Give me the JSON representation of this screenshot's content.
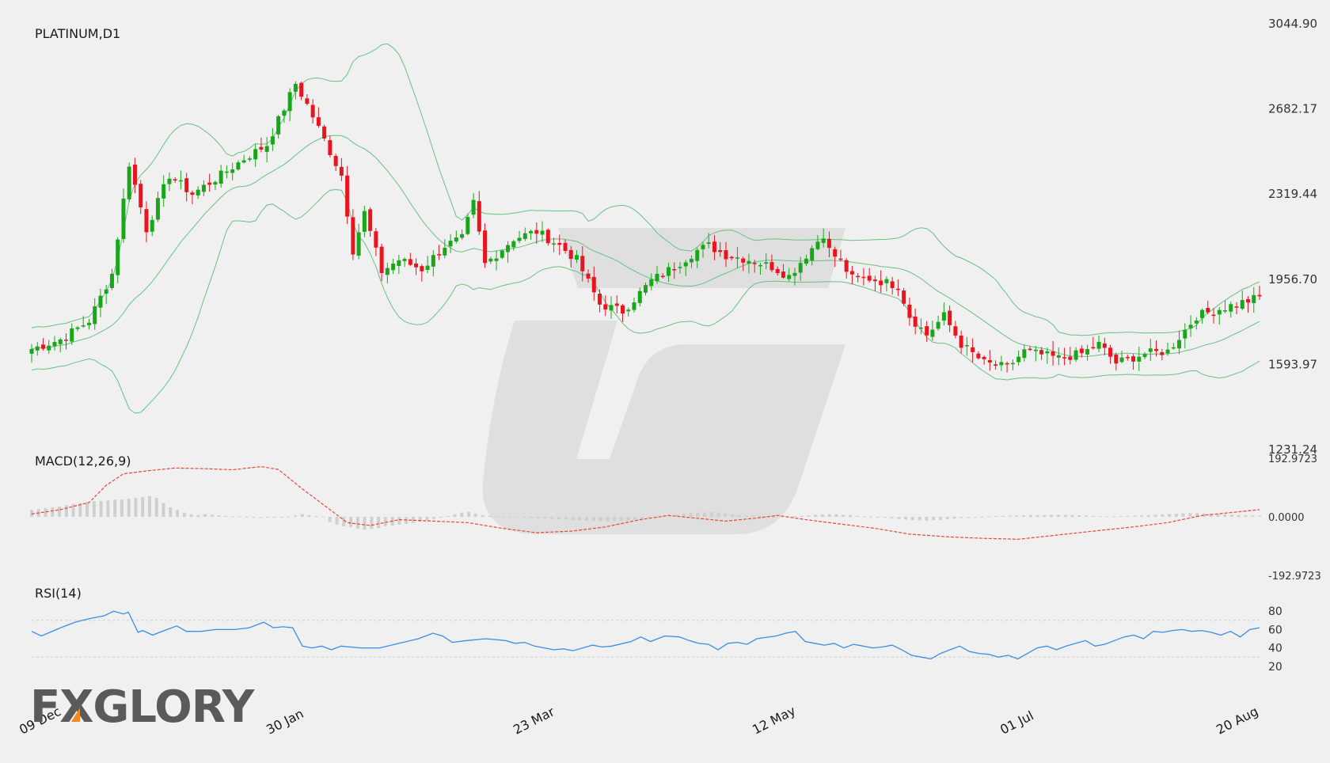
{
  "chart_data": [
    {
      "type": "candlestick",
      "title": "PLATINUM,D1",
      "y_ticks": [
        "3044.90",
        "2682.17",
        "2319.44",
        "1956.70",
        "1593.97",
        "1231.24"
      ],
      "ylim": [
        1231.24,
        3044.9
      ],
      "x_ticks": [
        "09 Dec",
        "30 Jan",
        "23 Mar",
        "12 May",
        "01 Jul",
        "20 Aug"
      ],
      "overlay": "Bollinger Bands",
      "grid": false,
      "colors": {
        "up": "#1aa61a",
        "down": "#e8141f",
        "bands": "#66c183"
      },
      "close_path": [
        [
          0,
          1660
        ],
        [
          5,
          1700
        ],
        [
          10,
          1780
        ],
        [
          14,
          1980
        ],
        [
          17,
          2450
        ],
        [
          20,
          2170
        ],
        [
          24,
          2400
        ],
        [
          28,
          2320
        ],
        [
          33,
          2400
        ],
        [
          37,
          2470
        ],
        [
          41,
          2530
        ],
        [
          46,
          2790
        ],
        [
          48,
          2700
        ],
        [
          51,
          2550
        ],
        [
          54,
          2400
        ],
        [
          56,
          2080
        ],
        [
          58,
          2240
        ],
        [
          61,
          1990
        ],
        [
          64,
          2040
        ],
        [
          68,
          2000
        ],
        [
          72,
          2100
        ],
        [
          75,
          2130
        ],
        [
          77,
          2280
        ],
        [
          79,
          2020
        ],
        [
          84,
          2130
        ],
        [
          88,
          2160
        ],
        [
          92,
          2100
        ],
        [
          95,
          2040
        ],
        [
          99,
          1850
        ],
        [
          103,
          1820
        ],
        [
          108,
          1950
        ],
        [
          112,
          2010
        ],
        [
          116,
          2080
        ],
        [
          118,
          2100
        ],
        [
          121,
          2060
        ],
        [
          125,
          2040
        ],
        [
          129,
          2010
        ],
        [
          132,
          1970
        ],
        [
          135,
          2060
        ],
        [
          138,
          2150
        ],
        [
          139,
          2080
        ],
        [
          141,
          2030
        ],
        [
          143,
          1960
        ],
        [
          146,
          1960
        ],
        [
          151,
          1930
        ],
        [
          153,
          1800
        ],
        [
          156,
          1720
        ],
        [
          159,
          1800
        ],
        [
          162,
          1680
        ],
        [
          166,
          1600
        ],
        [
          170,
          1580
        ],
        [
          173,
          1650
        ],
        [
          179,
          1620
        ],
        [
          183,
          1640
        ],
        [
          186,
          1680
        ],
        [
          189,
          1600
        ],
        [
          194,
          1640
        ],
        [
          198,
          1650
        ],
        [
          203,
          1800
        ],
        [
          207,
          1830
        ],
        [
          214,
          1880
        ]
      ]
    },
    {
      "type": "line",
      "title": "MACD(12,26,9)",
      "y_ticks": [
        "192.9723",
        "0.0000",
        "-192.9723"
      ],
      "ylim": [
        -192.9723,
        192.9723
      ],
      "series": [
        {
          "line": "signal",
          "color": "#e8453c",
          "points": [
            [
              0,
              10
            ],
            [
              5,
              25
            ],
            [
              10,
              50
            ],
            [
              13,
              110
            ],
            [
              16,
              150
            ],
            [
              20,
              160
            ],
            [
              25,
              170
            ],
            [
              30,
              168
            ],
            [
              35,
              164
            ],
            [
              40,
              175
            ],
            [
              43,
              165
            ],
            [
              47,
              100
            ],
            [
              51,
              40
            ],
            [
              55,
              -20
            ],
            [
              59,
              -30
            ],
            [
              64,
              -10
            ],
            [
              70,
              -15
            ],
            [
              76,
              -20
            ],
            [
              82,
              -40
            ],
            [
              88,
              -55
            ],
            [
              94,
              -50
            ],
            [
              100,
              -35
            ],
            [
              106,
              -10
            ],
            [
              111,
              5
            ],
            [
              116,
              -5
            ],
            [
              121,
              -15
            ],
            [
              126,
              -5
            ],
            [
              130,
              5
            ],
            [
              135,
              -10
            ],
            [
              141,
              -25
            ],
            [
              147,
              -40
            ],
            [
              153,
              -60
            ],
            [
              160,
              -70
            ],
            [
              166,
              -75
            ],
            [
              172,
              -78
            ],
            [
              178,
              -65
            ],
            [
              185,
              -50
            ],
            [
              192,
              -35
            ],
            [
              198,
              -20
            ],
            [
              204,
              5
            ],
            [
              209,
              15
            ],
            [
              214,
              25
            ]
          ]
        },
        {
          "name": "",
          "type": "histogram",
          "color": "#cfcfcf",
          "values": [
            40,
            45,
            50,
            55,
            60,
            68,
            75,
            80,
            85,
            90,
            92,
            95,
            100,
            100,
            105,
            110,
            115,
            120,
            110,
            80,
            55,
            40,
            25,
            15,
            10,
            15,
            12,
            8,
            5,
            3,
            2,
            1,
            -1,
            -2,
            -3,
            -2,
            -1,
            1,
            8,
            15,
            10,
            5,
            2,
            -30,
            -45,
            -55,
            -60,
            -70,
            -75,
            -70,
            -65,
            -55,
            -50,
            -45,
            -40,
            -35,
            -28,
            -20,
            -12,
            -5,
            5,
            15,
            25,
            28,
            18,
            10,
            5,
            3,
            2,
            1,
            -2,
            -4,
            -6,
            -8,
            -10,
            -12,
            -14,
            -16,
            -18,
            -20,
            -22,
            -24,
            -26,
            -26,
            -24,
            -22,
            -20,
            -16,
            -12,
            -8,
            -4,
            2,
            8,
            14,
            18,
            22,
            25,
            26,
            27,
            24,
            20,
            15,
            12,
            9,
            6,
            4,
            3,
            2,
            2,
            3,
            4,
            6,
            8,
            12,
            14,
            15,
            14,
            12,
            10,
            6,
            3,
            1,
            -2,
            -5,
            -8,
            -12,
            -15,
            -18,
            -20,
            -21,
            -20,
            -18,
            -14,
            -10,
            -6,
            -3,
            -1,
            1,
            3,
            5,
            6,
            7,
            8,
            9,
            10,
            10,
            11,
            12,
            12,
            11,
            10,
            9,
            8,
            6,
            4,
            3,
            3,
            4,
            5,
            6,
            8,
            10,
            12,
            14,
            16,
            18,
            20,
            22,
            22,
            20,
            18,
            16,
            14,
            12,
            10,
            8,
            7,
            6
          ]
        }
      ]
    },
    {
      "type": "line",
      "title": "RSI(14)",
      "y_ticks": [
        "80",
        "60",
        "40",
        "20"
      ],
      "ylim": [
        0,
        100
      ],
      "levels": [
        70,
        30
      ],
      "color": "#3a8ee6",
      "points": [
        [
          0,
          58
        ],
        [
          2,
          53
        ],
        [
          6,
          62
        ],
        [
          9,
          68
        ],
        [
          12,
          72
        ],
        [
          15,
          75
        ],
        [
          17,
          80
        ],
        [
          19,
          77
        ],
        [
          20,
          79
        ],
        [
          22,
          57
        ],
        [
          23,
          59
        ],
        [
          25,
          54
        ],
        [
          28,
          60
        ],
        [
          30,
          64
        ],
        [
          32,
          58
        ],
        [
          35,
          58
        ],
        [
          38,
          60
        ],
        [
          42,
          60
        ],
        [
          45,
          62
        ],
        [
          48,
          68
        ],
        [
          50,
          62
        ],
        [
          52,
          63
        ],
        [
          54,
          62
        ],
        [
          56,
          42
        ],
        [
          58,
          40
        ],
        [
          60,
          42
        ],
        [
          62,
          38
        ],
        [
          64,
          42
        ],
        [
          68,
          40
        ],
        [
          72,
          40
        ],
        [
          76,
          45
        ],
        [
          80,
          50
        ],
        [
          83,
          56
        ],
        [
          85,
          53
        ],
        [
          87,
          46
        ],
        [
          90,
          48
        ],
        [
          94,
          50
        ],
        [
          98,
          48
        ],
        [
          100,
          45
        ],
        [
          102,
          46
        ],
        [
          104,
          42
        ],
        [
          108,
          38
        ],
        [
          110,
          39
        ],
        [
          112,
          37
        ],
        [
          114,
          40
        ],
        [
          116,
          43
        ],
        [
          118,
          41
        ],
        [
          120,
          42
        ],
        [
          124,
          47
        ],
        [
          126,
          52
        ],
        [
          128,
          47
        ],
        [
          131,
          53
        ],
        [
          134,
          52
        ],
        [
          136,
          48
        ],
        [
          138,
          45
        ],
        [
          140,
          44
        ],
        [
          142,
          38
        ],
        [
          144,
          45
        ],
        [
          146,
          46
        ],
        [
          148,
          44
        ],
        [
          150,
          50
        ],
        [
          154,
          53
        ],
        [
          156,
          56
        ],
        [
          158,
          58
        ],
        [
          160,
          47
        ],
        [
          162,
          45
        ],
        [
          164,
          43
        ],
        [
          166,
          45
        ],
        [
          168,
          40
        ],
        [
          170,
          44
        ],
        [
          172,
          42
        ],
        [
          174,
          40
        ],
        [
          176,
          41
        ],
        [
          178,
          43
        ],
        [
          180,
          38
        ],
        [
          182,
          32
        ],
        [
          184,
          30
        ],
        [
          186,
          28
        ],
        [
          188,
          34
        ],
        [
          190,
          38
        ],
        [
          192,
          42
        ],
        [
          194,
          36
        ],
        [
          196,
          34
        ],
        [
          198,
          33
        ],
        [
          200,
          30
        ],
        [
          202,
          32
        ],
        [
          204,
          28
        ],
        [
          206,
          34
        ],
        [
          208,
          40
        ],
        [
          210,
          42
        ],
        [
          212,
          38
        ],
        [
          214,
          42
        ],
        [
          216,
          45
        ],
        [
          218,
          48
        ],
        [
          220,
          42
        ],
        [
          222,
          44
        ],
        [
          224,
          48
        ],
        [
          226,
          52
        ],
        [
          228,
          54
        ],
        [
          230,
          50
        ],
        [
          232,
          58
        ],
        [
          234,
          57
        ],
        [
          236,
          59
        ],
        [
          238,
          60
        ],
        [
          240,
          58
        ],
        [
          242,
          59
        ],
        [
          244,
          57
        ],
        [
          246,
          54
        ],
        [
          248,
          58
        ],
        [
          250,
          52
        ],
        [
          252,
          60
        ],
        [
          254,
          62
        ]
      ]
    }
  ],
  "logo": {
    "text": "FXGLORY",
    "accent_color": "#f08a24"
  }
}
